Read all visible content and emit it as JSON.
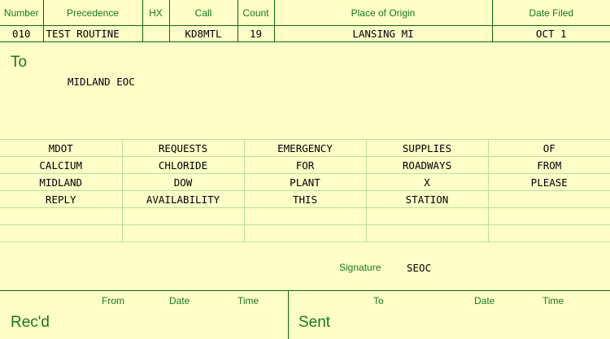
{
  "header": {
    "columns": [
      "Number",
      "Precedence",
      "HX",
      "Call",
      "Count",
      "Place of Origin",
      "Date Filed"
    ],
    "values": [
      "010",
      "TEST ROUTINE",
      "",
      "KD8MTL",
      "19",
      "LANSING MI",
      "OCT 1"
    ]
  },
  "to": {
    "label": "To",
    "value": "MIDLAND EOC"
  },
  "message": {
    "rows": [
      [
        "MDOT",
        "REQUESTS",
        "EMERGENCY",
        "SUPPLIES",
        "OF"
      ],
      [
        "CALCIUM",
        "CHLORIDE",
        "FOR",
        "ROADWAYS",
        "FROM"
      ],
      [
        "MIDLAND",
        "DOW",
        "PLANT",
        "X",
        "PLEASE"
      ],
      [
        "REPLY",
        "AVAILABILITY",
        "THIS",
        "STATION",
        ""
      ],
      [
        "",
        "",
        "",
        "",
        ""
      ],
      [
        "",
        "",
        "",
        "",
        ""
      ]
    ]
  },
  "signature": {
    "label": "Signature",
    "value": "SEOC"
  },
  "footer": {
    "received": {
      "title": "Rec'd",
      "from_label": "From",
      "date_label": "Date",
      "time_label": "Time"
    },
    "sent": {
      "title": "Sent",
      "to_label": "To",
      "date_label": "Date",
      "time_label": "Time"
    }
  },
  "colors": {
    "background": "#fffec8",
    "label_green": "#157a15",
    "rule_dark": "#0a6a0a",
    "rule_light": "#b7e29b"
  }
}
